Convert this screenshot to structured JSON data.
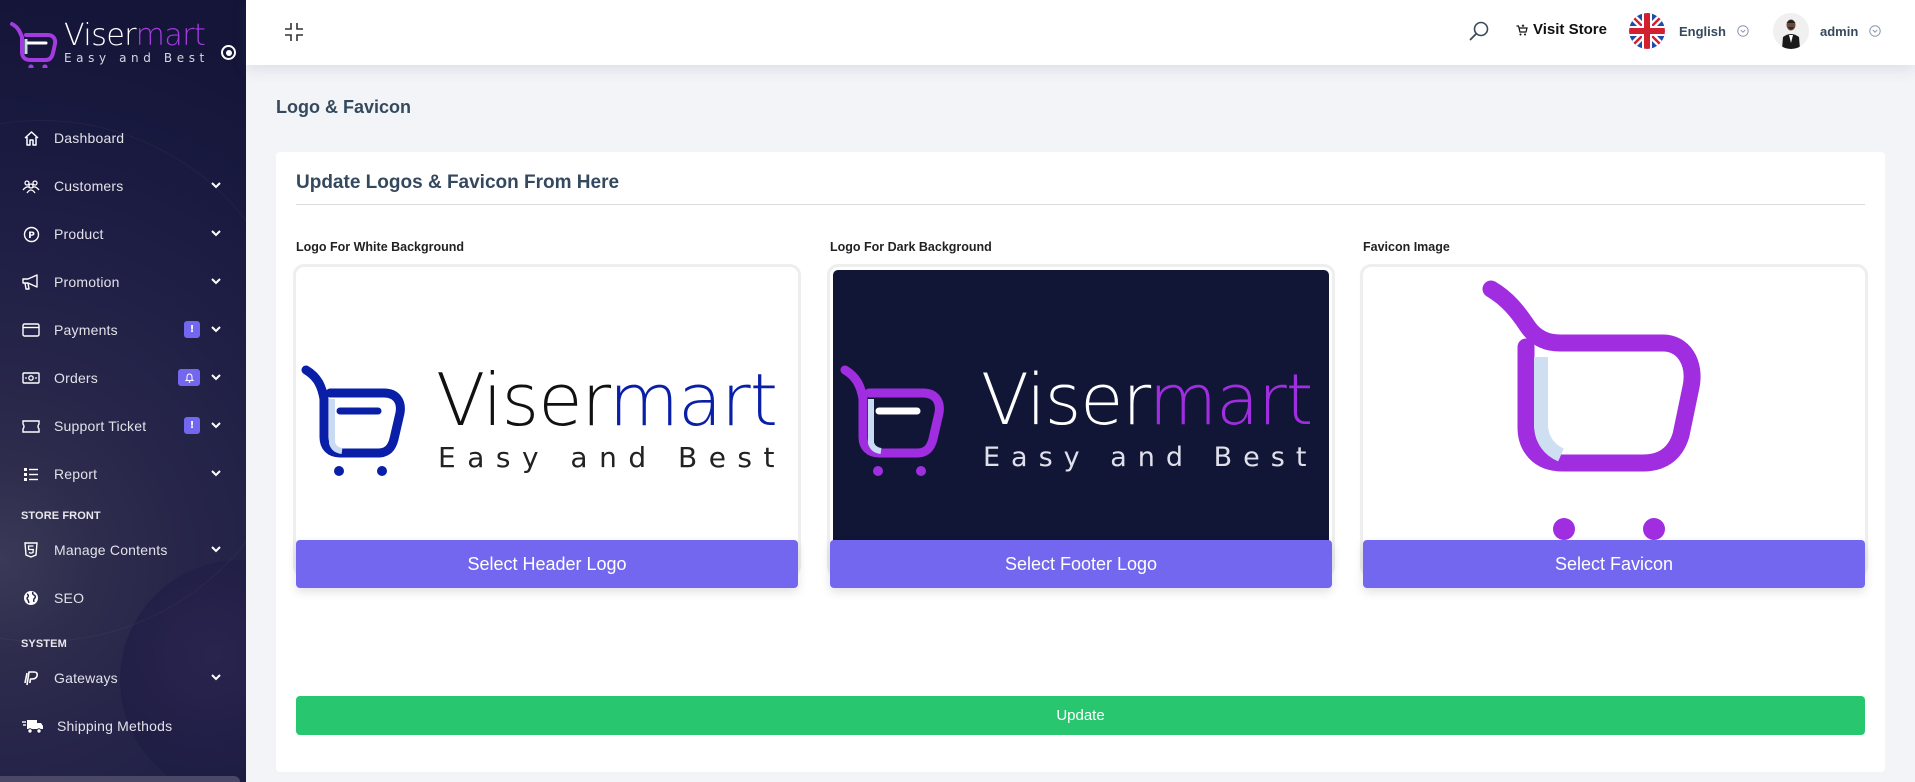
{
  "brand": {
    "name_main": "Viser",
    "name_accent": "mart",
    "tagline": "Easy and Best"
  },
  "sidebar": {
    "items": [
      {
        "label": "Dashboard",
        "icon": "home-icon",
        "has_submenu": false
      },
      {
        "label": "Customers",
        "icon": "users-icon",
        "has_submenu": true
      },
      {
        "label": "Product",
        "icon": "product-icon",
        "has_submenu": true
      },
      {
        "label": "Promotion",
        "icon": "megaphone-icon",
        "has_submenu": true
      },
      {
        "label": "Payments",
        "icon": "credit-card-icon",
        "has_submenu": true,
        "badge": "!"
      },
      {
        "label": "Orders",
        "icon": "money-icon",
        "has_submenu": true,
        "badge": "bell"
      },
      {
        "label": "Support Ticket",
        "icon": "ticket-icon",
        "has_submenu": true,
        "badge": "!"
      },
      {
        "label": "Report",
        "icon": "list-icon",
        "has_submenu": true
      }
    ],
    "section_store_front": "STORE FRONT",
    "store_front_items": [
      {
        "label": "Manage Contents",
        "icon": "html5-icon",
        "has_submenu": true
      },
      {
        "label": "SEO",
        "icon": "globe-icon",
        "has_submenu": false
      }
    ],
    "section_system": "SYSTEM",
    "system_items": [
      {
        "label": "Gateways",
        "icon": "paypal-icon",
        "has_submenu": true
      },
      {
        "label": "Shipping Methods",
        "icon": "truck-icon",
        "has_submenu": false
      }
    ]
  },
  "topbar": {
    "visit_store": "Visit Store",
    "language": "English",
    "username": "admin"
  },
  "page": {
    "title": "Logo & Favicon",
    "card_title": "Update Logos & Favicon From Here",
    "columns": [
      {
        "label": "Logo For White Background",
        "button": "Select Header Logo"
      },
      {
        "label": "Logo For Dark Background",
        "button": "Select Footer Logo"
      },
      {
        "label": "Favicon Image",
        "button": "Select Favicon"
      }
    ],
    "update_button": "Update"
  },
  "colors": {
    "primary": "#7367f0",
    "success": "#28c76f",
    "sidebar_bg": "#141538",
    "brand_purple": "#a02ee0",
    "brand_blue": "#0a1fa8"
  }
}
